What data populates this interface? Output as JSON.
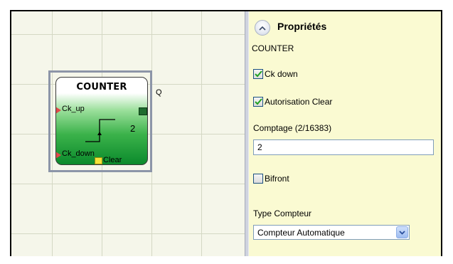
{
  "block": {
    "title": "COUNTER",
    "input1": "Ck_up",
    "input2": "Ck_down",
    "output": "Q",
    "value": "2",
    "clear_label": "Clear"
  },
  "panel": {
    "title": "Propriétés",
    "subtitle": "COUNTER",
    "checkbox_ck_down": {
      "label": "Ck down",
      "checked": true
    },
    "checkbox_autorisation_clear": {
      "label": "Autorisation Clear",
      "checked": true
    },
    "comptage": {
      "label": "Comptage (2/16383)",
      "value": "2"
    },
    "checkbox_bifront": {
      "label": "Bifront",
      "checked": false
    },
    "type_compteur": {
      "label": "Type Compteur",
      "selected": "Compteur Automatique"
    }
  },
  "icons": {
    "collapse": "chevron-up-icon",
    "check": "checkmark-icon",
    "dropdown": "chevron-down-icon"
  },
  "colors": {
    "panel_bg": "#fafad2",
    "block_green": "#0b8a2c",
    "pin_input": "#e04a4a",
    "pin_clear": "#f4e23a"
  }
}
